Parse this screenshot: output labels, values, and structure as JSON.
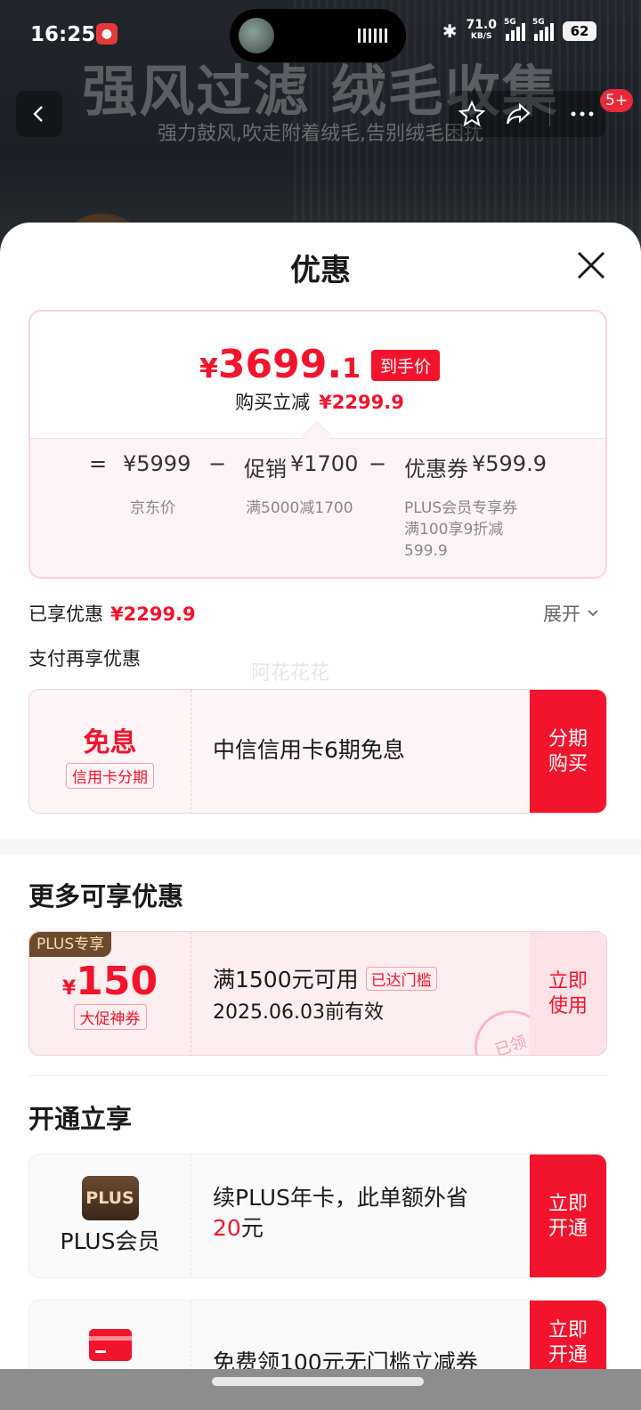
{
  "status_bar": {
    "time": "16:25",
    "speed_value": "71.0",
    "speed_unit": "KB/S",
    "network_1": "5G",
    "network_2": "5G",
    "battery": "62"
  },
  "product_page": {
    "headline": "强风过滤 绒毛收集",
    "subline": "强力鼓风,吹走附着绒毛,告别绒毛困扰",
    "cart_badge": "5+"
  },
  "sheet": {
    "title": "优惠",
    "price": {
      "symbol": "¥",
      "integer": "3699.",
      "decimal": "1",
      "tag": "到手价",
      "reduction_label": "购买立减",
      "reduction_value": "¥2299.9"
    },
    "breakdown": {
      "equals": "=",
      "minus": "−",
      "jd_price": "¥5999",
      "jd_price_desc": "京东价",
      "promo_label": "促销",
      "promo_value": "¥1700",
      "promo_desc": "满5000减1700",
      "coupon_label": "优惠券",
      "coupon_value": "¥599.9",
      "coupon_desc_1": "PLUS会员专享券",
      "coupon_desc_2": "满100享9折减",
      "coupon_desc_3": "599.9"
    },
    "enjoyed_label": "已享优惠",
    "enjoyed_value": "¥2299.9",
    "expand_label": "展开",
    "pay_more_label": "支付再享优惠",
    "watermark": "阿花花花",
    "installment": {
      "title": "免息",
      "tag": "信用卡分期",
      "desc": "中信信用卡6期免息",
      "button_line1": "分期",
      "button_line2": "购买"
    },
    "more_title": "更多可享优惠",
    "coupon": {
      "plus_tag": "PLUS专享",
      "symbol": "¥",
      "amount": "150",
      "type": "大促神券",
      "condition": "满1500元可用",
      "reached": "已达门槛",
      "expiry": "2025.06.03前有效",
      "stamp": "已领",
      "button_line1": "立即",
      "button_line2": "使用"
    },
    "open_title": "开通立享",
    "plus_member": {
      "logo_text": "PLUS",
      "name": "PLUS会员",
      "desc_line1": "续PLUS年卡，此单额外省",
      "desc_amount": "20",
      "desc_unit": "元",
      "button_line1": "立即",
      "button_line2": "开通"
    },
    "card_offer": {
      "desc": "免费领100元无门槛立减券",
      "button_line1": "立即",
      "button_line2": "开通"
    }
  },
  "colors": {
    "accent": "#f2142c",
    "plus_brown": "#6e4a2c"
  }
}
